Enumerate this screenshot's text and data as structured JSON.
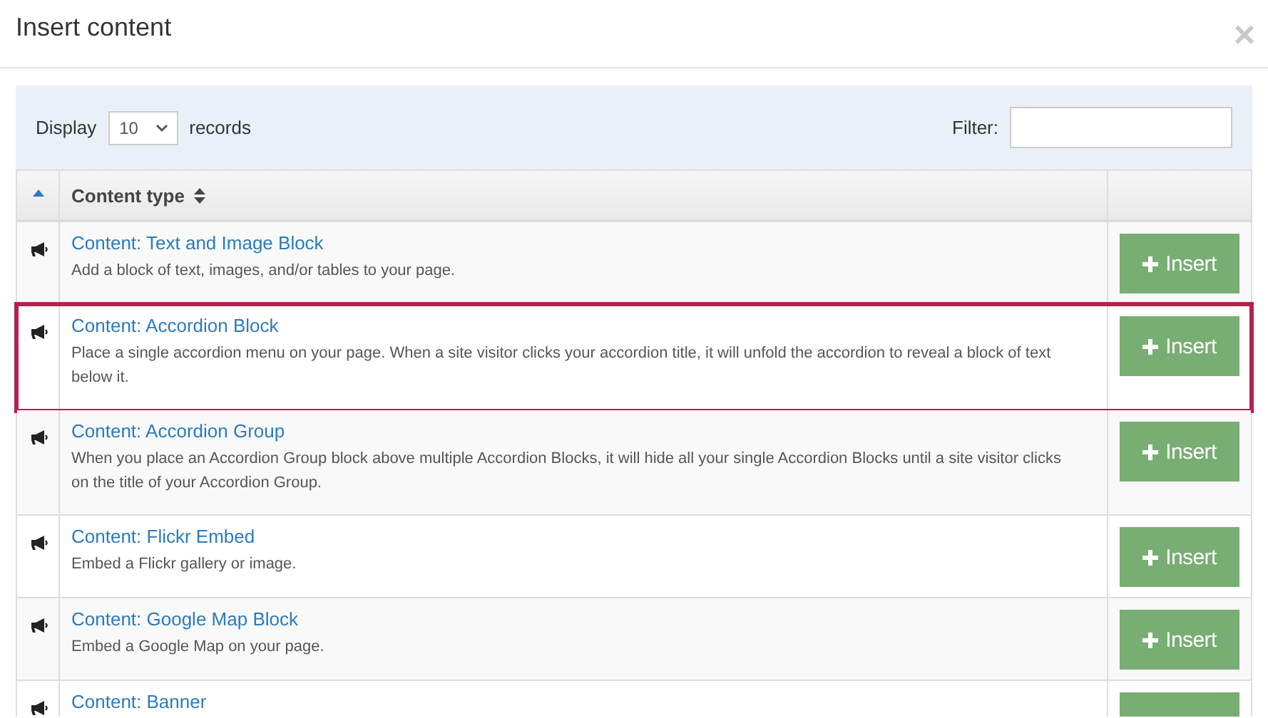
{
  "dialog": {
    "title": "Insert content",
    "close_label": "×"
  },
  "toolbar": {
    "display_label": "Display",
    "page_size": "10",
    "records_label": "records",
    "filter_label": "Filter:"
  },
  "table": {
    "columns": [
      {
        "kind": "sort-indicator",
        "sorted": true
      },
      {
        "label": "Content type",
        "kind": "sortable",
        "sorted": false
      },
      {
        "kind": "action",
        "sorted": false
      }
    ],
    "rows": [
      {
        "title": "Content: Text and Image Block",
        "description": "Add a block of text, images, and/or tables to your page.",
        "button": "Insert",
        "highlighted": false
      },
      {
        "title": "Content: Accordion Block",
        "description": "Place a single accordion menu on your page. When a site visitor clicks your accordion title, it will unfold the accordion to reveal a block of text below it.",
        "button": "Insert",
        "highlighted": true
      },
      {
        "title": "Content: Accordion Group",
        "description": "When you place an Accordion Group block above multiple Accordion Blocks, it will hide all your single Accordion Blocks until a site visitor clicks on the title of your Accordion Group.",
        "button": "Insert",
        "highlighted": false
      },
      {
        "title": "Content: Flickr Embed",
        "description": "Embed a Flickr gallery or image.",
        "button": "Insert",
        "highlighted": false
      },
      {
        "title": "Content: Google Map Block",
        "description": "Embed a Google Map on your page.",
        "button": "Insert",
        "highlighted": false
      },
      {
        "title": "Content: Banner",
        "highlighted": false
      }
    ]
  }
}
